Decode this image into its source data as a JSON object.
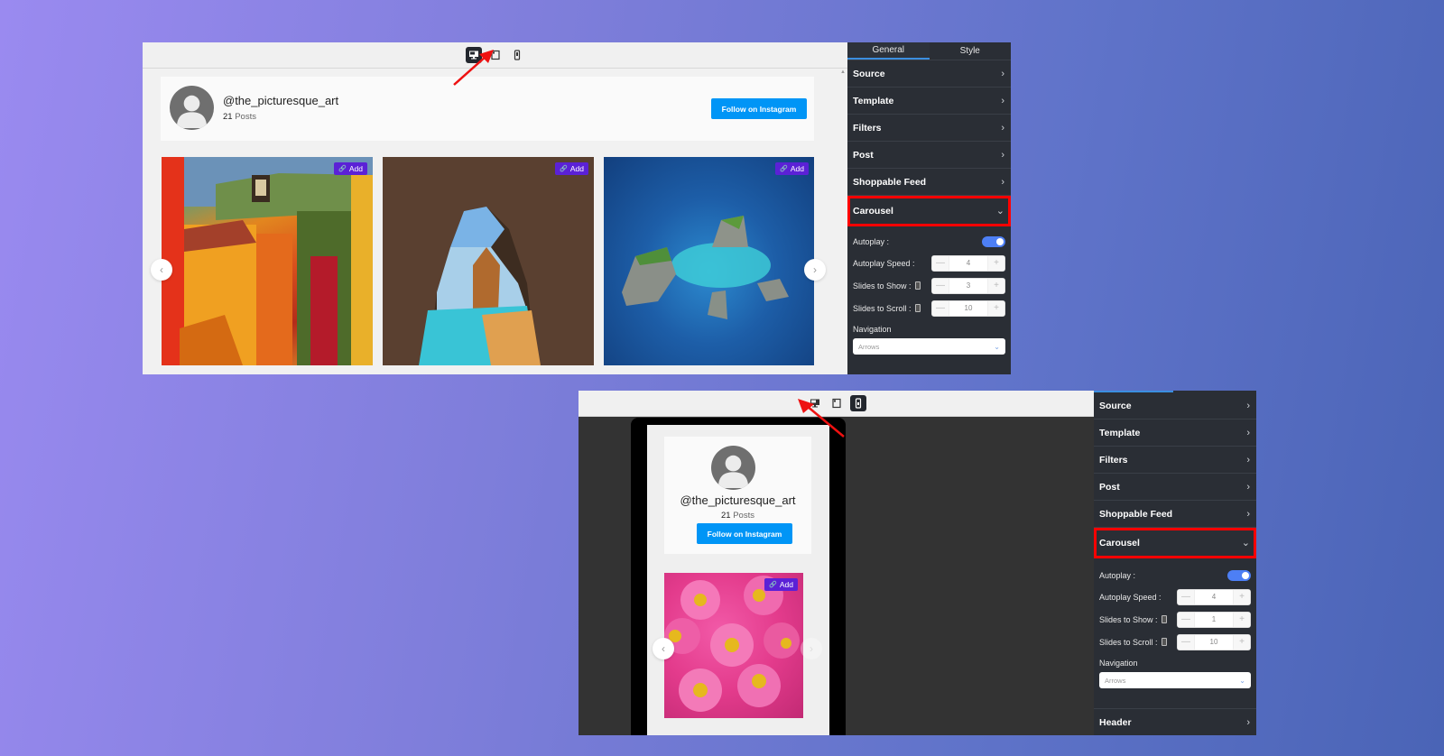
{
  "colors": {
    "sidebar_bg": "#2a2e35",
    "accent_blue": "#0095f6",
    "toggle_on": "#4d7ff5",
    "highlight_red": "#ff0000",
    "add_badge": "#5b21d6"
  },
  "desktop_view": {
    "device_bar": {
      "icons": [
        "desktop-icon",
        "tablet-icon",
        "mobile-icon"
      ],
      "active": "desktop"
    },
    "profile": {
      "username": "@the_picturesque_art",
      "posts_count": "21",
      "posts_label": "Posts",
      "follow_button": "Follow on Instagram"
    },
    "posts": [
      {
        "subject": "colorful-lakeside-street",
        "badge": "Add"
      },
      {
        "subject": "sea-cave-beach-arch",
        "badge": "Add"
      },
      {
        "subject": "tropical-islands-aerial",
        "badge": "Add"
      }
    ],
    "prev_arrow": "‹",
    "next_arrow": "›",
    "sidebar": {
      "tabs": [
        {
          "label": "General",
          "active": true
        },
        {
          "label": "Style",
          "active": false
        }
      ],
      "sections": [
        "Source",
        "Template",
        "Filters",
        "Post",
        "Shoppable Feed"
      ],
      "carousel": {
        "title": "Carousel",
        "autoplay_label": "Autoplay :",
        "autoplay_on": true,
        "autoplay_speed_label": "Autoplay Speed :",
        "autoplay_speed": "4",
        "slides_to_show_label": "Slides to Show :",
        "slides_to_show": "3",
        "slides_to_scroll_label": "Slides to Scroll :",
        "slides_to_scroll": "10",
        "navigation_label": "Navigation",
        "navigation_value": "Arrows"
      }
    }
  },
  "mobile_view": {
    "device_bar": {
      "icons": [
        "desktop-icon",
        "tablet-icon",
        "mobile-icon"
      ],
      "active": "mobile"
    },
    "profile": {
      "username": "@the_picturesque_art",
      "posts_count": "21",
      "posts_label": "Posts",
      "follow_button": "Follow on Instagram"
    },
    "posts": [
      {
        "subject": "pink-daisies",
        "badge": "Add"
      }
    ],
    "prev_arrow": "‹",
    "next_arrow": "›",
    "sidebar": {
      "sections": [
        "Source",
        "Template",
        "Filters",
        "Post",
        "Shoppable Feed"
      ],
      "carousel": {
        "title": "Carousel",
        "autoplay_label": "Autoplay :",
        "autoplay_on": true,
        "autoplay_speed_label": "Autoplay Speed :",
        "autoplay_speed": "4",
        "slides_to_show_label": "Slides to Show :",
        "slides_to_show": "1",
        "slides_to_scroll_label": "Slides to Scroll :",
        "slides_to_scroll": "10",
        "navigation_label": "Navigation",
        "navigation_value": "Arrows"
      },
      "after_sections": [
        "Header"
      ]
    }
  },
  "icons": {
    "chevron_right": "›",
    "chevron_down": "⌄",
    "minus": "—",
    "plus": "+",
    "link": "🔗"
  }
}
